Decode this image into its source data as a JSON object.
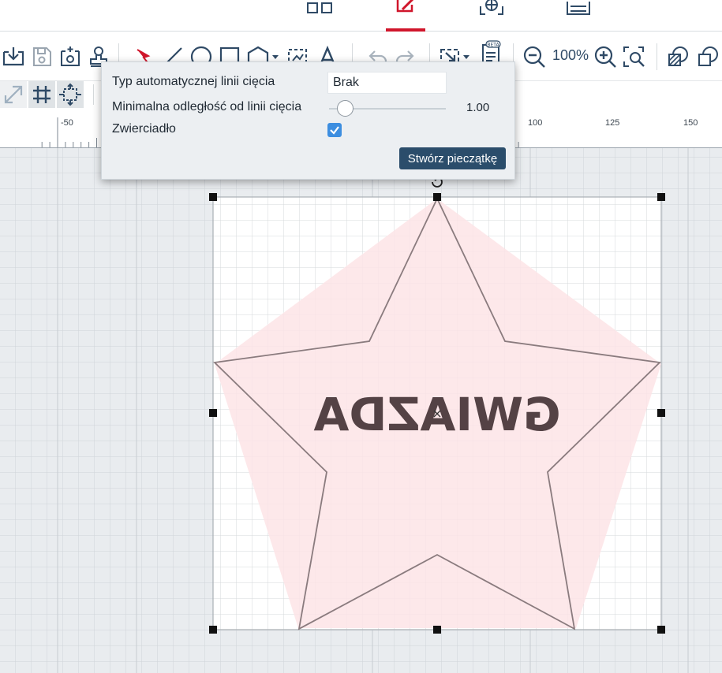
{
  "toolbar": {
    "zoom_level": "100%"
  },
  "ruler": {
    "labels": [
      "-50",
      "100",
      "125",
      "150"
    ]
  },
  "popup": {
    "cut_line_type_label": "Typ automatycznej linii cięcia",
    "cut_line_type_value": "Brak",
    "min_distance_label": "Minimalna odległość od linii cięcia",
    "min_distance_value": "1.00",
    "min_distance_fraction": 0.07,
    "mirror_label": "Zwierciadło",
    "mirror_checked": true,
    "create_button_label": "Stwórz pieczątkę"
  },
  "canvas": {
    "stamp_text": "GWIAZDA",
    "mirrored": true
  },
  "colors": {
    "accent_red": "#d0162b",
    "toolbar_icon": "#2f4a66",
    "button_dark": "#2b4d6b",
    "checkbox_blue": "#3d8ee0",
    "cut_zone_pink": "#fde4e6"
  }
}
